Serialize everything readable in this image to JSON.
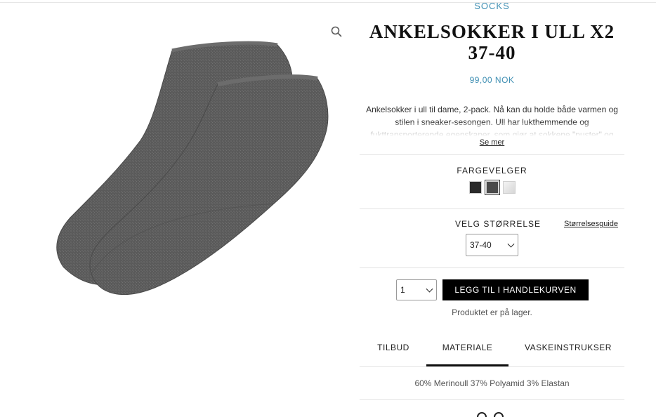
{
  "product": {
    "category": "SOCKS",
    "title": "ANKELSOKKER I ULL X2 37-40",
    "price": "99,00 NOK",
    "description": "Ankelsokker i ull til dame, 2-pack. Nå kan du holde både varmen og stilen i sneaker-sesongen. Ull har lukthemmende og fukttransporterende egenskaper, som gjør at sokkene \"puster\" og",
    "see_more": "Se mer",
    "image_alt": "product-photo"
  },
  "color_picker": {
    "label": "FARGEVELGER",
    "swatches": [
      {
        "name": "black",
        "color": "#2a2a2a",
        "selected": false
      },
      {
        "name": "dark-grey",
        "color": "#4a4a4a",
        "selected": true
      },
      {
        "name": "light-grey",
        "color": "#e4e4e4",
        "selected": false
      }
    ]
  },
  "size": {
    "label": "VELG STØRRELSE",
    "guide_link": "Størrelsesguide",
    "selected": "37-40"
  },
  "cart": {
    "quantity": "1",
    "add_button": "LEGG TIL I HANDLEKURVEN",
    "stock_status": "Produktet er på lager."
  },
  "tabs": {
    "items": [
      "TILBUD",
      "MATERIALE",
      "VASKEINSTRUKSER"
    ],
    "active": "MATERIALE",
    "content": "60% Merinoull 37% Polyamid 3% Elastan"
  },
  "icons": {
    "zoom": "magnifier-icon",
    "dropdown": "chevron-down-icon"
  },
  "colors": {
    "accent": "#3f8fb3",
    "button_bg": "#000000"
  }
}
